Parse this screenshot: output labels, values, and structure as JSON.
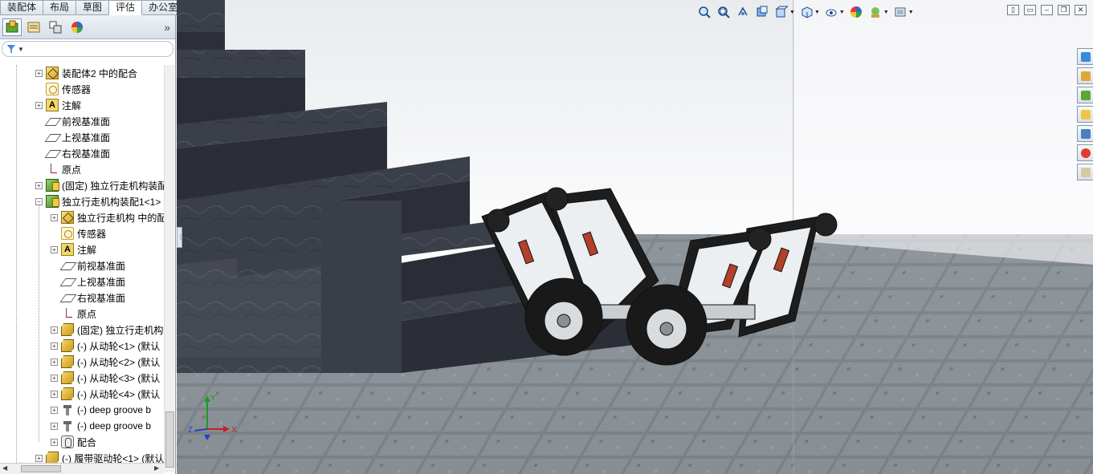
{
  "tabs": [
    "装配体",
    "布局",
    "草图",
    "评估",
    "办公室产品"
  ],
  "active_tab": 3,
  "panel_toolbar": {
    "icons": [
      "feature-manager-icon",
      "property-manager-icon",
      "configuration-manager-icon",
      "display-manager-icon"
    ],
    "expand_glyph": "»"
  },
  "tree_items": [
    {
      "indent": 0,
      "expander": "+",
      "icon": "mate-group-icon",
      "label": "装配体2 中的配合"
    },
    {
      "indent": 0,
      "expander": "",
      "icon": "sensor-icon",
      "label": "传感器"
    },
    {
      "indent": 0,
      "expander": "+",
      "icon": "annotation-icon",
      "label": "注解"
    },
    {
      "indent": 0,
      "expander": "",
      "icon": "plane-icon",
      "label": "前视基准面"
    },
    {
      "indent": 0,
      "expander": "",
      "icon": "plane-icon",
      "label": "上视基准面"
    },
    {
      "indent": 0,
      "expander": "",
      "icon": "plane-icon",
      "label": "右视基准面"
    },
    {
      "indent": 0,
      "expander": "",
      "icon": "origin-icon",
      "label": "原点"
    },
    {
      "indent": 0,
      "expander": "+",
      "icon": "assembly-icon",
      "label": "(固定) 独立行走机构装配"
    },
    {
      "indent": 0,
      "expander": "−",
      "icon": "assembly-icon",
      "label": "独立行走机构装配1<1>"
    },
    {
      "indent": 1,
      "expander": "+",
      "icon": "mate-group-icon",
      "label": "独立行走机构 中的配合"
    },
    {
      "indent": 1,
      "expander": "",
      "icon": "sensor-icon",
      "label": "传感器"
    },
    {
      "indent": 1,
      "expander": "+",
      "icon": "annotation-icon",
      "label": "注解"
    },
    {
      "indent": 1,
      "expander": "",
      "icon": "plane-icon",
      "label": "前视基准面"
    },
    {
      "indent": 1,
      "expander": "",
      "icon": "plane-icon",
      "label": "上视基准面"
    },
    {
      "indent": 1,
      "expander": "",
      "icon": "plane-icon",
      "label": "右视基准面"
    },
    {
      "indent": 1,
      "expander": "",
      "icon": "origin-icon",
      "label": "原点"
    },
    {
      "indent": 1,
      "expander": "+",
      "icon": "part-icon",
      "label": "(固定) 独立行走机构"
    },
    {
      "indent": 1,
      "expander": "+",
      "icon": "part-icon",
      "label": "(-) 从动轮<1> (默认"
    },
    {
      "indent": 1,
      "expander": "+",
      "icon": "part-icon",
      "label": "(-) 从动轮<2> (默认"
    },
    {
      "indent": 1,
      "expander": "+",
      "icon": "part-icon",
      "label": "(-) 从动轮<3> (默认"
    },
    {
      "indent": 1,
      "expander": "+",
      "icon": "part-icon",
      "label": "(-) 从动轮<4> (默认"
    },
    {
      "indent": 1,
      "expander": "+",
      "icon": "bolt-icon",
      "label": "(-) deep groove b"
    },
    {
      "indent": 1,
      "expander": "+",
      "icon": "bolt-icon",
      "label": "(-) deep groove b"
    },
    {
      "indent": 1,
      "expander": "+",
      "icon": "mates-icon",
      "label": "配合"
    },
    {
      "indent": 0,
      "expander": "+",
      "icon": "part-icon",
      "label": "(-) 履带驱动轮<1> (默认"
    }
  ],
  "hud_icons": [
    "zoom-to-fit-icon",
    "zoom-to-area-icon",
    "previous-view-icon",
    "section-view-icon",
    "view-orientation-icon",
    "display-style-icon",
    "hide-show-items-icon",
    "edit-appearance-icon",
    "apply-scene-icon",
    "view-settings-icon"
  ],
  "window_controls": [
    "tile-horizontal-icon",
    "tile-vertical-icon",
    "minimize-icon",
    "restore-icon",
    "close-icon"
  ],
  "task_pane_icons": [
    "solidworks-resources-icon",
    "design-library-icon",
    "file-explorer-icon",
    "search-icon",
    "view-palette-icon",
    "appearances-icon",
    "custom-properties-icon"
  ],
  "triad": {
    "x": "X",
    "y": "Y",
    "z": "Z"
  }
}
